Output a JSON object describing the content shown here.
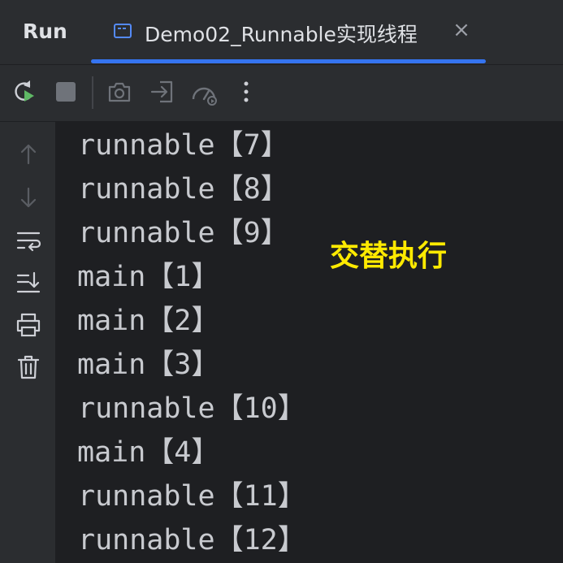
{
  "header": {
    "panel_title": "Run",
    "tab": {
      "label": "Demo02_Runnable实现线程",
      "close": "×"
    }
  },
  "toolbar": {
    "buttons": [
      "rerun-icon",
      "stop-icon",
      "camera-icon",
      "import-icon",
      "profiler-icon",
      "more-vertical-icon"
    ]
  },
  "gutter": {
    "buttons": [
      "arrow-up-icon",
      "arrow-down-icon",
      "soft-wrap-icon",
      "scroll-to-end-icon",
      "print-icon",
      "trash-icon"
    ]
  },
  "console": {
    "lines": [
      "runnable【7】",
      "runnable【8】",
      "runnable【9】",
      "main【1】",
      "main【2】",
      "main【3】",
      "runnable【10】",
      "main【4】",
      "runnable【11】",
      "runnable【12】"
    ]
  },
  "annotation": "交替执行",
  "colors": {
    "background": "#1e1f22",
    "panel": "#2b2d30",
    "accent": "#3574f0",
    "text": "#c8cacf",
    "annotation": "#ffea00",
    "run_green": "#5fb865"
  }
}
